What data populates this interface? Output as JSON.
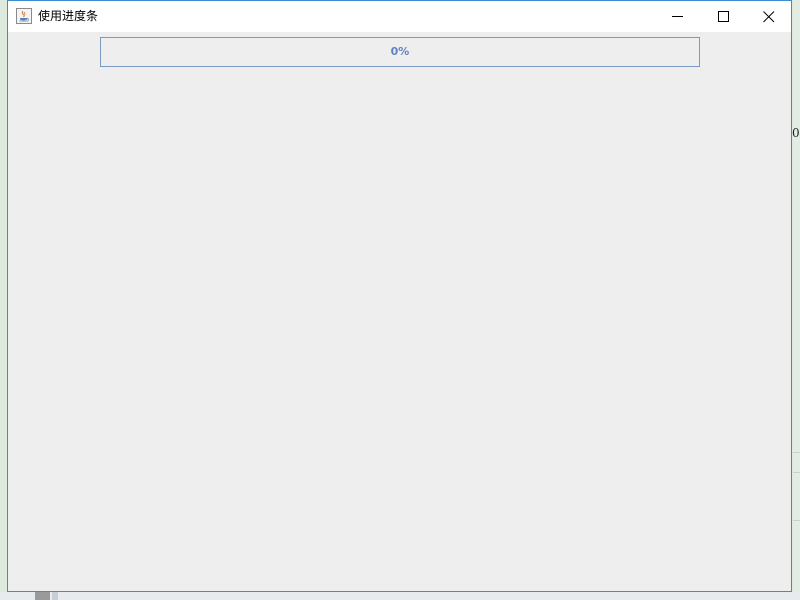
{
  "window": {
    "title": "使用进度条"
  },
  "progress_bar": {
    "value": 0,
    "max": 100,
    "text": "0%"
  },
  "background": {
    "fragment_text": "0,"
  },
  "colors": {
    "window_border": "#3c8cd0",
    "progress_border": "#7c9bc0",
    "progress_text": "#6382bf",
    "client_bg": "#eeeeee"
  },
  "icons": {
    "app": "java-cup-icon",
    "minimize": "minimize-icon",
    "maximize": "maximize-icon",
    "close": "close-icon"
  }
}
